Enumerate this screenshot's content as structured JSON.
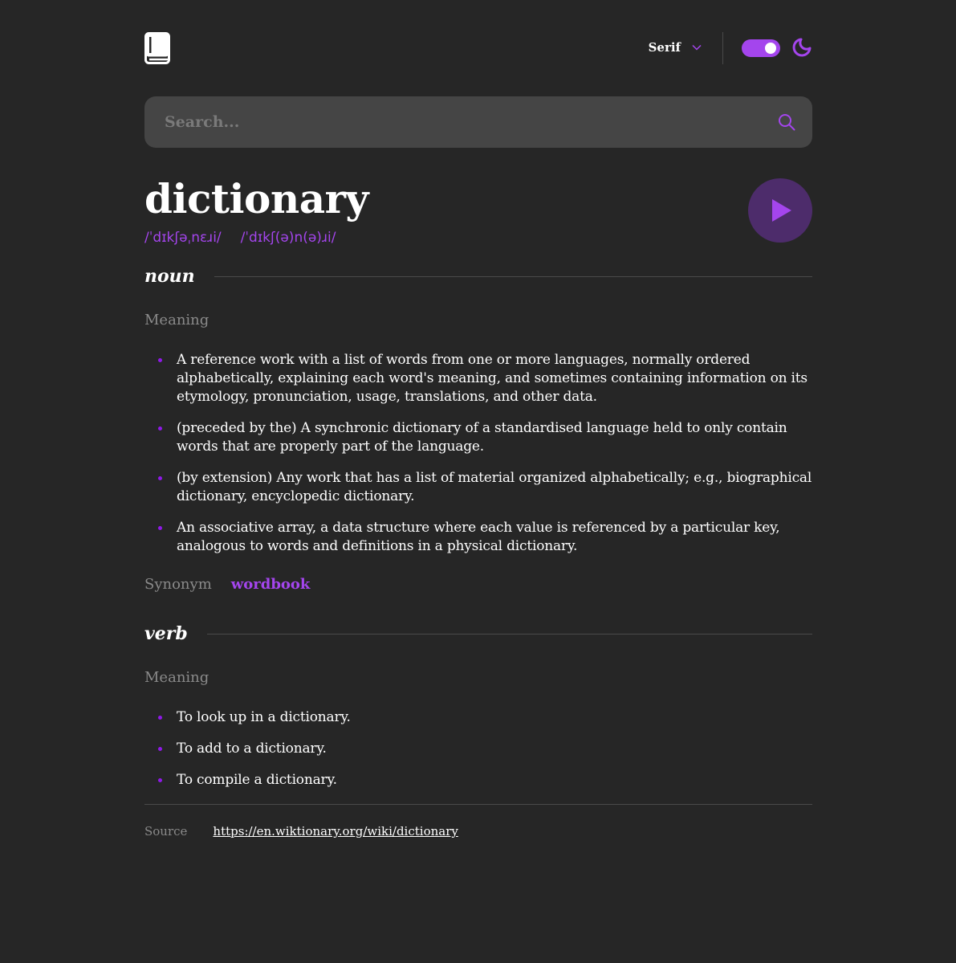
{
  "header": {
    "font_selected": "Serif",
    "theme_toggle_on": true
  },
  "search": {
    "placeholder": "Search...",
    "value": ""
  },
  "word": {
    "text": "dictionary",
    "phonetics": [
      "/ˈdɪkʃəˌnɛɹi/",
      "/ˈdɪkʃ(ə)n(ə)ɹi/"
    ]
  },
  "meanings": [
    {
      "part_of_speech": "noun",
      "heading": "Meaning",
      "definitions": [
        "A reference work with a list of words from one or more languages, normally ordered alphabetically, explaining each word's meaning, and sometimes containing information on its etymology, pronunciation, usage, translations, and other data.",
        "(preceded by the) A synchronic dictionary of a standardised language held to only contain words that are properly part of the language.",
        "(by extension) Any work that has a list of material organized alphabetically; e.g., biographical dictionary, encyclopedic dictionary.",
        "An associative array, a data structure where each value is referenced by a particular key, analogous to words and definitions in a physical dictionary."
      ],
      "synonym_label": "Synonym",
      "synonym": "wordbook"
    },
    {
      "part_of_speech": "verb",
      "heading": "Meaning",
      "definitions": [
        "To look up in a dictionary.",
        "To add to a dictionary.",
        "To compile a dictionary."
      ]
    }
  ],
  "source": {
    "label": "Source",
    "url": "https://en.wiktionary.org/wiki/dictionary"
  },
  "colors": {
    "background": "#262626",
    "accent": "#a445ed",
    "search_bg": "#454545",
    "muted_text": "#8a8a8a"
  },
  "icons": {
    "logo": "book-icon",
    "dropdown": "chevron-down-icon",
    "theme": "moon-icon",
    "search": "search-icon",
    "play": "play-icon"
  }
}
